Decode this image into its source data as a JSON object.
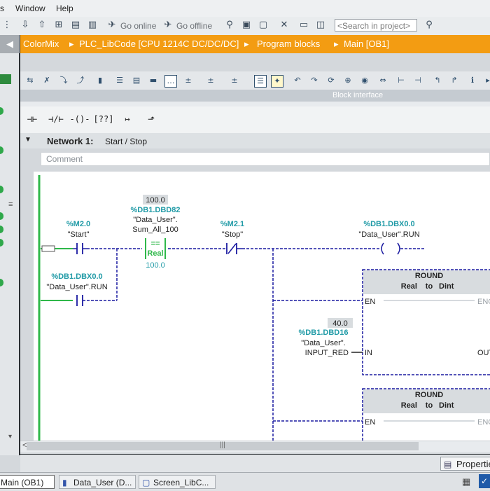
{
  "menu": {
    "items": [
      "s",
      "Window",
      "Help"
    ]
  },
  "toolbar": {
    "go_online": "Go online",
    "go_offline": "Go offline",
    "search_placeholder": "<Search in project>"
  },
  "breadcrumb": {
    "items": [
      "ColorMix",
      "PLC_LibCode [CPU 1214C DC/DC/DC]",
      "Program blocks",
      "Main [OB1]"
    ],
    "separator": "▸"
  },
  "editor": {
    "block_interface": "Block interface"
  },
  "favorites": [
    "-|  |-",
    "-|/|-",
    "-( )-",
    "[??]",
    "↦",
    "↗"
  ],
  "network": {
    "title": "Network 1:",
    "subtitle": "Start / Stop",
    "comment_placeholder": "Comment"
  },
  "ladder": {
    "contact_start": {
      "address": "%M2.0",
      "tag": "\"Start\""
    },
    "compare": {
      "value": "100.0",
      "address": "%DB1.DBD82",
      "tag1": "\"Data_User\".",
      "tag2": "Sum_All_100",
      "op": "==",
      "type": "Real",
      "ref": "100.0"
    },
    "contact_stop": {
      "address": "%M2.1",
      "tag": "\"Stop\""
    },
    "coil_run": {
      "address": "%DB1.DBX0.0",
      "tag": "\"Data_User\".RUN"
    },
    "contact_run": {
      "address": "%DB1.DBX0.0",
      "tag": "\"Data_User\".RUN"
    },
    "round1": {
      "title": "ROUND",
      "conv_from": "Real",
      "conv_to_word": "to",
      "conv_to": "Dint",
      "en": "EN",
      "eno": "ENO",
      "in": "IN",
      "out": "OUT"
    },
    "input": {
      "value": "40.0",
      "address": "%DB1.DBD16",
      "tag1": "\"Data_User\".",
      "tag2": "INPUT_RED"
    },
    "round2": {
      "title": "ROUND",
      "conv_from": "Real",
      "conv_to_word": "to",
      "conv_to": "Dint",
      "en": "EN",
      "eno": "ENO"
    }
  },
  "bottom": {
    "properties": "Properties"
  },
  "taskbar": {
    "items": [
      "Main (OB1)",
      "Data_User (D...",
      "Screen_LibC..."
    ]
  },
  "colors": {
    "accent": "#f39c12",
    "tag_address": "#1f9aa6",
    "wire": "#1a1aa0",
    "power_rail": "#2fb84a",
    "compare_box": "#2fb84a"
  }
}
